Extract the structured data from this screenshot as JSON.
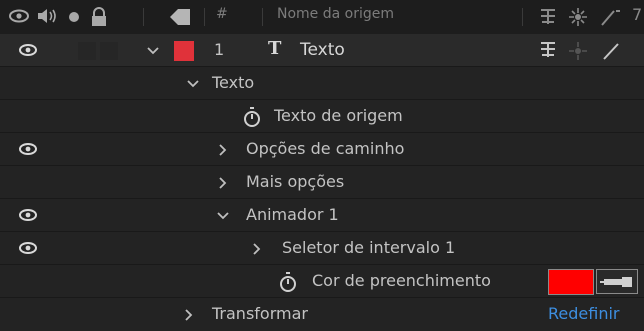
{
  "header": {
    "hash_label": "#",
    "source_name_label": "Nome da origem"
  },
  "layer": {
    "number": "1",
    "type_glyph": "T",
    "name": "Texto",
    "label_color": "#e0323a"
  },
  "properties": [
    {
      "label": "Texto",
      "expanded": true
    },
    {
      "label": "Texto de origem"
    },
    {
      "label": "Opções de caminho",
      "expanded": false
    },
    {
      "label": "Mais opções",
      "expanded": false
    },
    {
      "label": "Animador 1",
      "expanded": true
    },
    {
      "label": "Seletor de intervalo 1",
      "expanded": false
    },
    {
      "label": "Cor de preenchimento",
      "color_value": "#ff0000"
    },
    {
      "label": "Transformar",
      "expanded": false,
      "action": "Redefinir"
    }
  ],
  "colors": {
    "accent_link": "#3d8ee0",
    "panel_bg": "#1f1f1f",
    "fill_swatch": "#ff0000"
  }
}
